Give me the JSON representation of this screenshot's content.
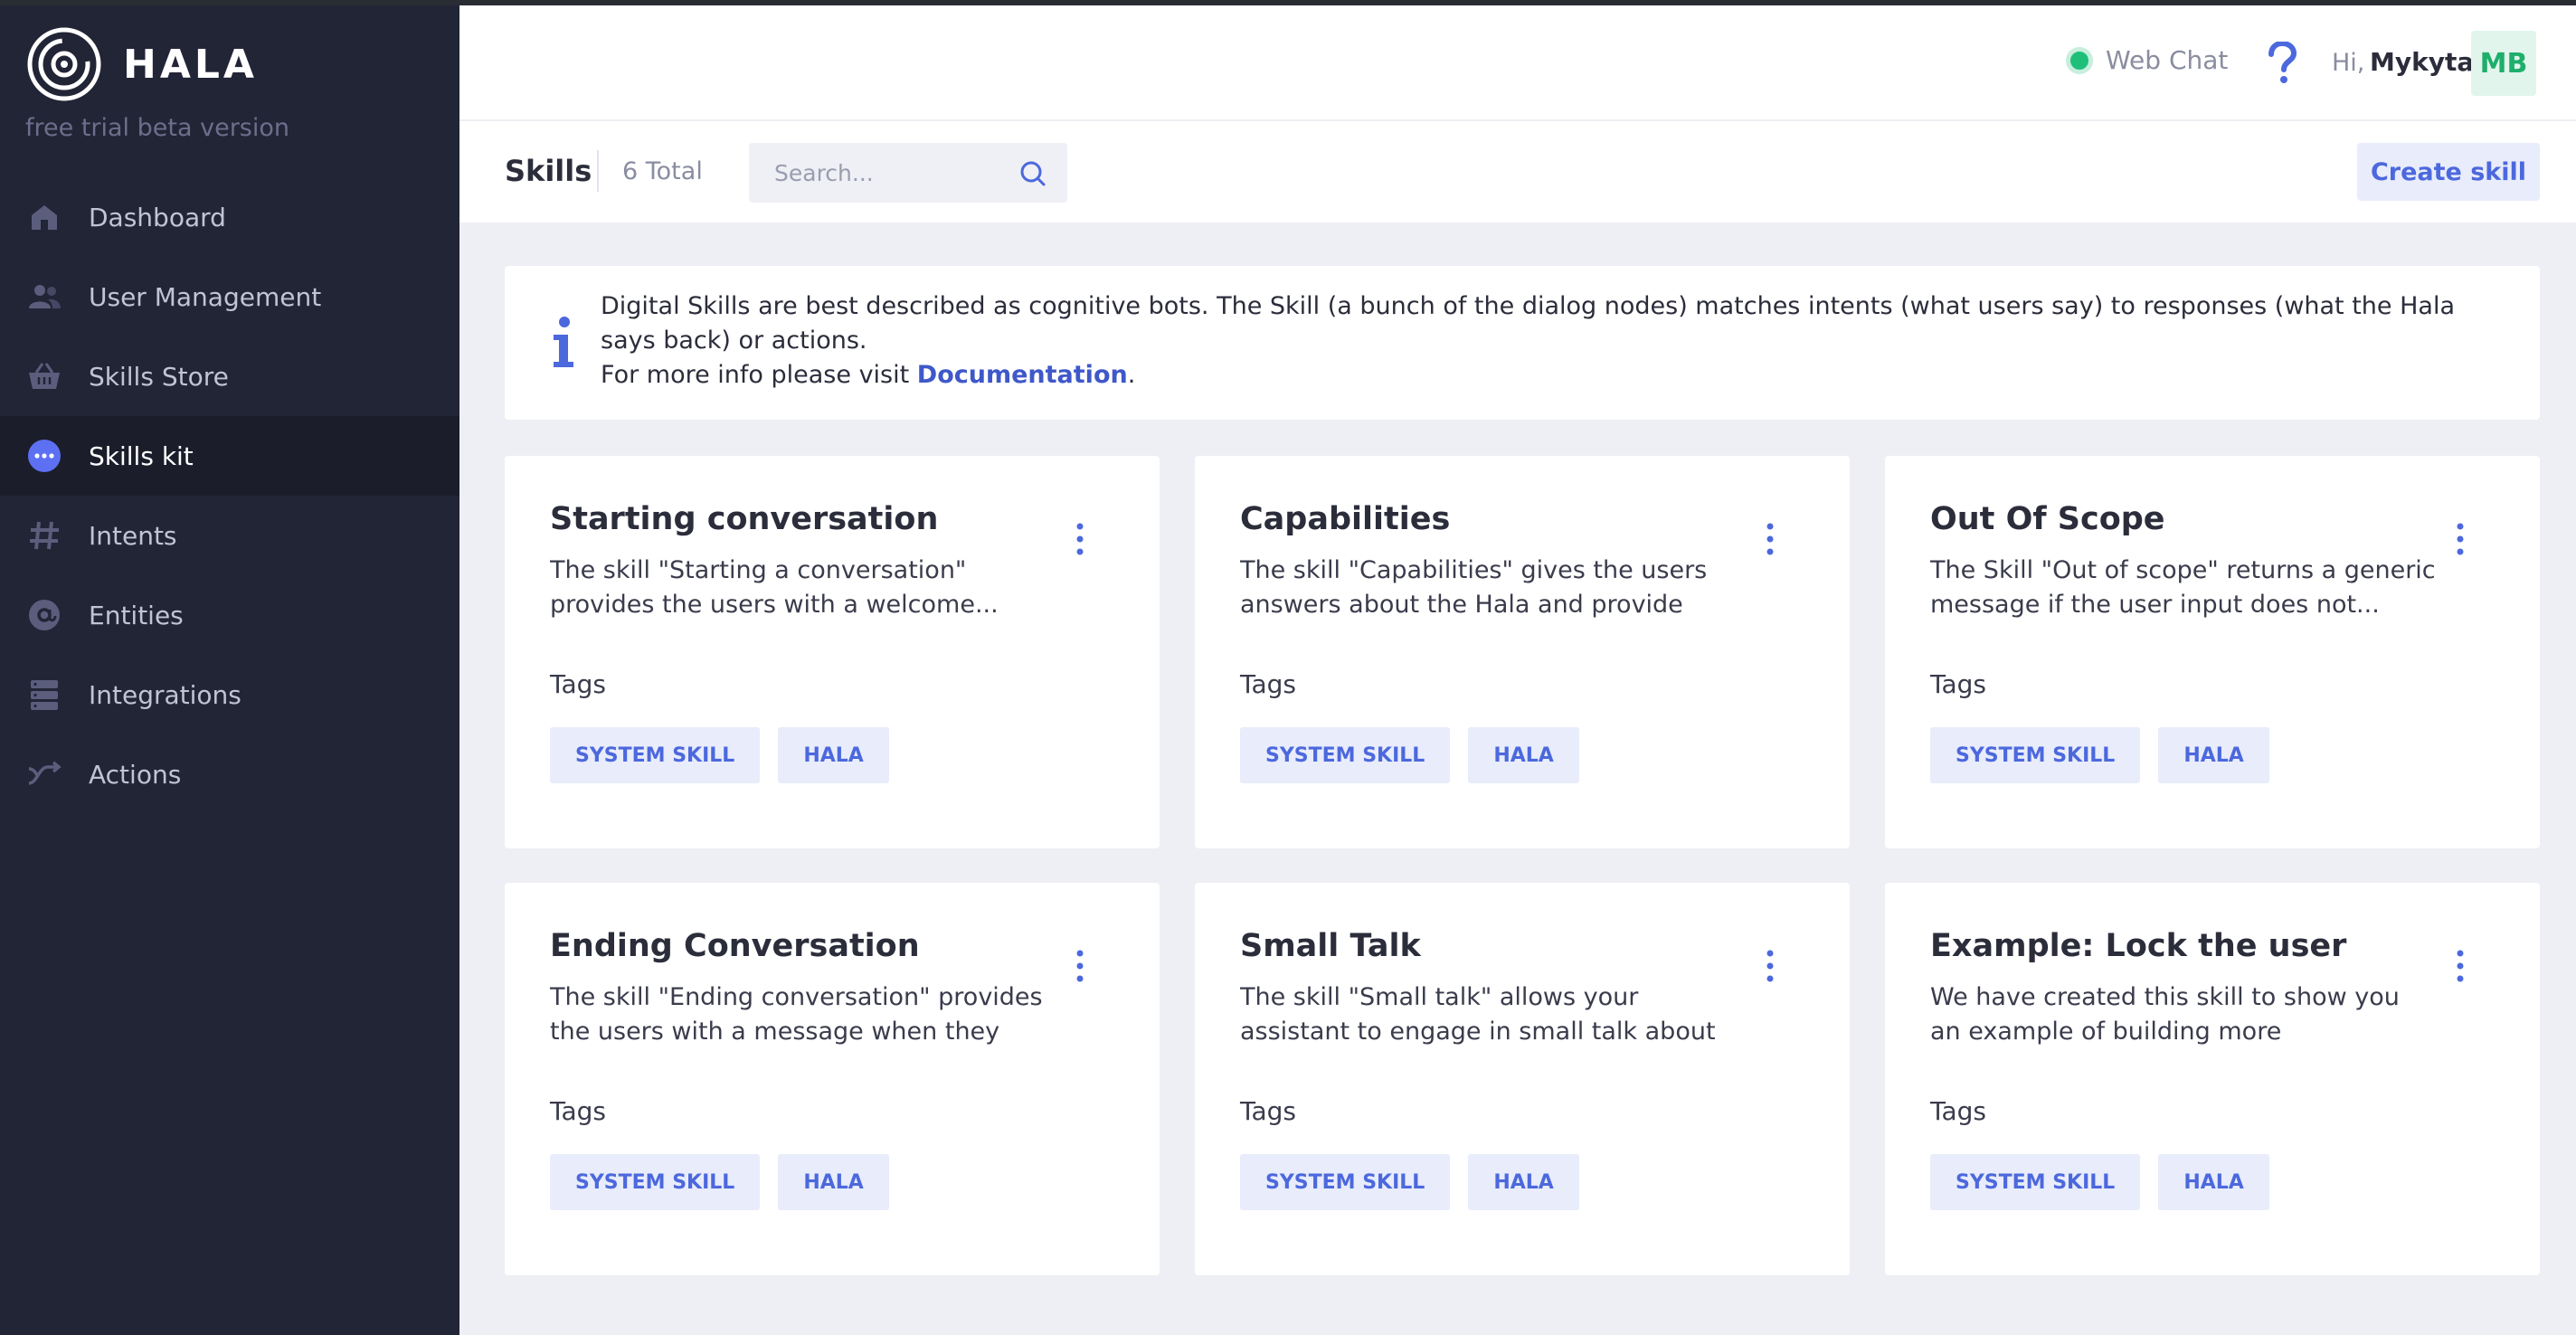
{
  "brand": {
    "name": "HALA",
    "subtitle": "free trial beta version"
  },
  "sidebar": {
    "items": [
      {
        "label": "Dashboard",
        "icon": "home-icon",
        "active": false
      },
      {
        "label": "User Management",
        "icon": "users-icon",
        "active": false
      },
      {
        "label": "Skills Store",
        "icon": "basket-icon",
        "active": false
      },
      {
        "label": "Skills kit",
        "icon": "chat-dots-icon",
        "active": true
      },
      {
        "label": "Intents",
        "icon": "hash-icon",
        "active": false
      },
      {
        "label": "Entities",
        "icon": "at-icon",
        "active": false
      },
      {
        "label": "Integrations",
        "icon": "server-icon",
        "active": false
      },
      {
        "label": "Actions",
        "icon": "shuffle-icon",
        "active": false
      }
    ]
  },
  "header": {
    "webchat_label": "Web Chat",
    "greeting": "Hi,",
    "username": "Mykyta",
    "avatar_initials": "MB",
    "help_icon": "question-icon"
  },
  "toolbar": {
    "title": "Skills",
    "total": "6 Total",
    "search_placeholder": "Search...",
    "create_label": "Create skill"
  },
  "info": {
    "line1": "Digital Skills are best described as cognitive bots. The Skill (a bunch of the dialog nodes) matches intents (what users say) to responses (what the Hala says back) or actions.",
    "line2_prefix": "For more info please visit ",
    "link": "Documentation",
    "line2_suffix": "."
  },
  "cards": [
    {
      "title": "Starting conversation",
      "desc": "The skill \"Starting a conversation\" provides the users with a welcome...",
      "tags_label": "Tags",
      "tags": [
        "SYSTEM SKILL",
        "HALA"
      ]
    },
    {
      "title": "Capabilities",
      "desc": "The skill \"Capabilities\" gives the users answers about the Hala and provide the...",
      "tags_label": "Tags",
      "tags": [
        "SYSTEM SKILL",
        "HALA"
      ]
    },
    {
      "title": "Out Of Scope",
      "desc": "The Skill \"Out of scope\" returns a generic message if the user input does not...",
      "tags_label": "Tags",
      "tags": [
        "SYSTEM SKILL",
        "HALA"
      ]
    },
    {
      "title": "Ending Conversation",
      "desc": "The skill \"Ending conversation\" provides the users with a message when they say...",
      "tags_label": "Tags",
      "tags": [
        "SYSTEM SKILL",
        "HALA"
      ]
    },
    {
      "title": "Small Talk",
      "desc": "The skill \"Small talk\" allows your assistant to engage in small talk about different...",
      "tags_label": "Tags",
      "tags": [
        "SYSTEM SKILL",
        "HALA"
      ]
    },
    {
      "title": "Example: Lock the user",
      "desc": "We have created this skill to show you an example of building more complicated...",
      "tags_label": "Tags",
      "tags": [
        "SYSTEM SKILL",
        "HALA"
      ]
    }
  ],
  "colors": {
    "sidebar_bg": "#222536",
    "accent": "#4c68dd",
    "status_online": "#1fbf7a",
    "content_bg": "#eeeff4"
  }
}
